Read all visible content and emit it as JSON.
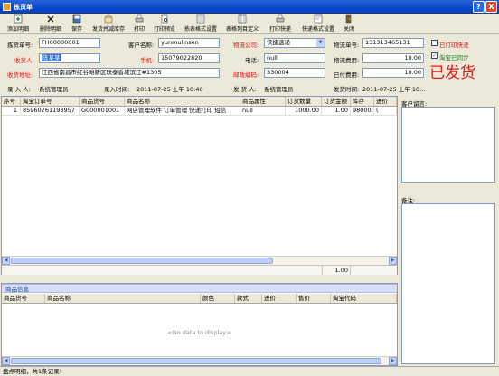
{
  "window": {
    "title": "拣货单",
    "help": "?",
    "close": "X"
  },
  "toolbar": [
    {
      "label": "添加明细",
      "icon": "add-detail-icon"
    },
    {
      "label": "删除明细",
      "icon": "delete-icon"
    },
    {
      "label": "保存",
      "icon": "save-icon"
    },
    {
      "label": "发货并减库存",
      "icon": "ship-icon"
    },
    {
      "label": "打印",
      "icon": "print-icon"
    },
    {
      "label": "打印预览",
      "icon": "print-preview-icon"
    },
    {
      "label": "拣表格式设置",
      "icon": "format-settings-icon"
    },
    {
      "label": "表格列目定义",
      "icon": "columns-icon"
    },
    {
      "label": "打印快递",
      "icon": "print-express-icon"
    },
    {
      "label": "快递格式设置",
      "icon": "express-format-icon"
    },
    {
      "label": "关闭",
      "icon": "exit-icon"
    }
  ],
  "form": {
    "order_no_label": "拣货单号:",
    "order_no": "FH00000001",
    "customer_label": "客户名称:",
    "customer": "yunmulinsen",
    "express_company_label": "物流公司:",
    "express_company": "快捷速递",
    "tracking_no_label": "物流单号:",
    "tracking_no": "131313465131",
    "printed_label": "已打印快递",
    "receiver_label": "收货人:",
    "receiver": "陈某某",
    "mobile_label": "手机:",
    "mobile": "15079022820",
    "phone_label": "电话:",
    "phone": "null",
    "shipping_fee_label": "物流费用:",
    "shipping_fee": "10.00",
    "taobao_sync_label": "淘宝已同步",
    "address_label": "收货地址:",
    "address": "江西省南昌市红谷滩新区联泰香域滨江#1305",
    "postcode_label": "邮政编码:",
    "postcode": "330004",
    "paid_fee_label": "已付费用:",
    "paid_fee": "10.00",
    "stamp": "已发货",
    "entered_by_label": "录 入 人:",
    "entered_by": "系统管理员",
    "entry_time_label": "录入时间:",
    "entry_time": "2011-07-25 上午 10:40",
    "shipper_label": "发 货 人:",
    "shipper": "系统管理员",
    "ship_time_label": "发货时间:",
    "ship_time": "2011-07-25 上午 10:.."
  },
  "order_table": {
    "headers": [
      "序号",
      "淘宝订单号",
      "商品货号",
      "商品名称",
      "商品属性",
      "订货数量",
      "订货金额",
      "库存",
      "进价"
    ],
    "rows": [
      [
        "1",
        "85960761193957",
        "G000001001",
        "网店管理软件 订单管理 快递打印 短信",
        "null",
        "1000.00",
        "1.00",
        "98000.0",
        "("
      ]
    ],
    "total_amount": "1.00"
  },
  "right_panel": {
    "customer_message_label": "客户留言:",
    "remark_label": "备注:"
  },
  "product_info": {
    "title": "商品信息",
    "headers": [
      "商品货号",
      "商品名称",
      "颜色",
      "款式",
      "进价",
      "售价",
      "淘宝代码"
    ],
    "empty_text": "<No data to display>"
  },
  "status_bar": {
    "text": "盘点明细，共1条记录!"
  },
  "colors": {
    "title_bar": "#0a46c8",
    "stamp": "#e01818",
    "required_label": "#d41010",
    "panel_head": "#d6dff7"
  }
}
